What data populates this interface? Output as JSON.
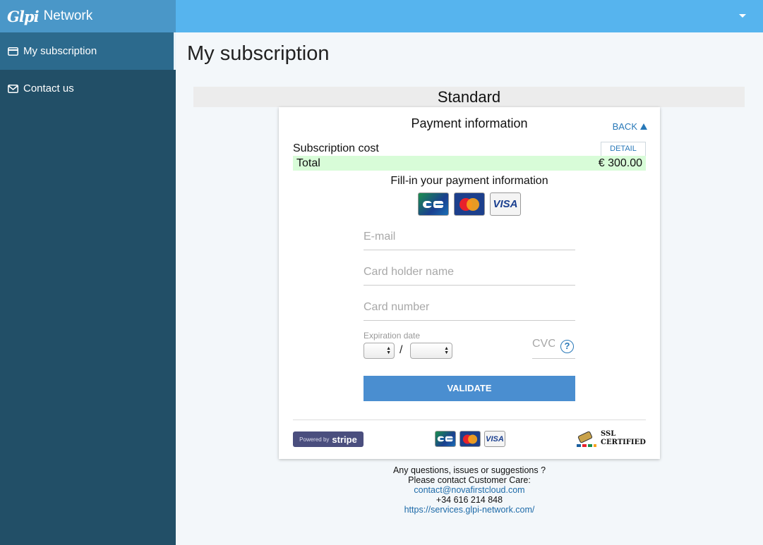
{
  "brand": {
    "logo": "Glpi",
    "name": "Network"
  },
  "sidebar": {
    "items": [
      {
        "label": "My subscription",
        "icon": "credit-card-icon",
        "active": true
      },
      {
        "label": "Contact us",
        "icon": "envelope-icon",
        "active": false
      }
    ]
  },
  "topbar": {
    "menu_icon": "caret-down-icon"
  },
  "page": {
    "title": "My subscription"
  },
  "plan": {
    "name": "Standard"
  },
  "payment": {
    "title": "Payment information",
    "back_label": "BACK",
    "subscription_cost_label": "Subscription cost",
    "detail_label": "DETAIL",
    "total_label": "Total",
    "total_value": "€ 300.00",
    "fill_in_label": "Fill-in your payment information",
    "card_brands": [
      "CB",
      "Mastercard",
      "VISA"
    ],
    "visa_text": "VISA",
    "email_placeholder": "E-mail",
    "holder_placeholder": "Card holder name",
    "card_number_placeholder": "Card number",
    "expiration_label": "Expiration date",
    "expiration_separator": "/",
    "cvc_placeholder": "CVC",
    "cvc_help": "?",
    "validate_label": "VALIDATE",
    "powered_by": "Powered by",
    "stripe": "stripe",
    "ssl_line1": "SSL",
    "ssl_line2": "CERTIFIED"
  },
  "footer": {
    "line1": "Any questions, issues or suggestions ?",
    "line2": "Please contact Customer Care:",
    "email": "contact@novafirstcloud.com",
    "phone": "+34 616 214 848",
    "url": "https://services.glpi-network.com/"
  },
  "colors": {
    "sidebar": "#224f67",
    "topbar": "#56b4ee",
    "accent": "#4a8ed0",
    "total_bg": "#d8fcd8"
  }
}
